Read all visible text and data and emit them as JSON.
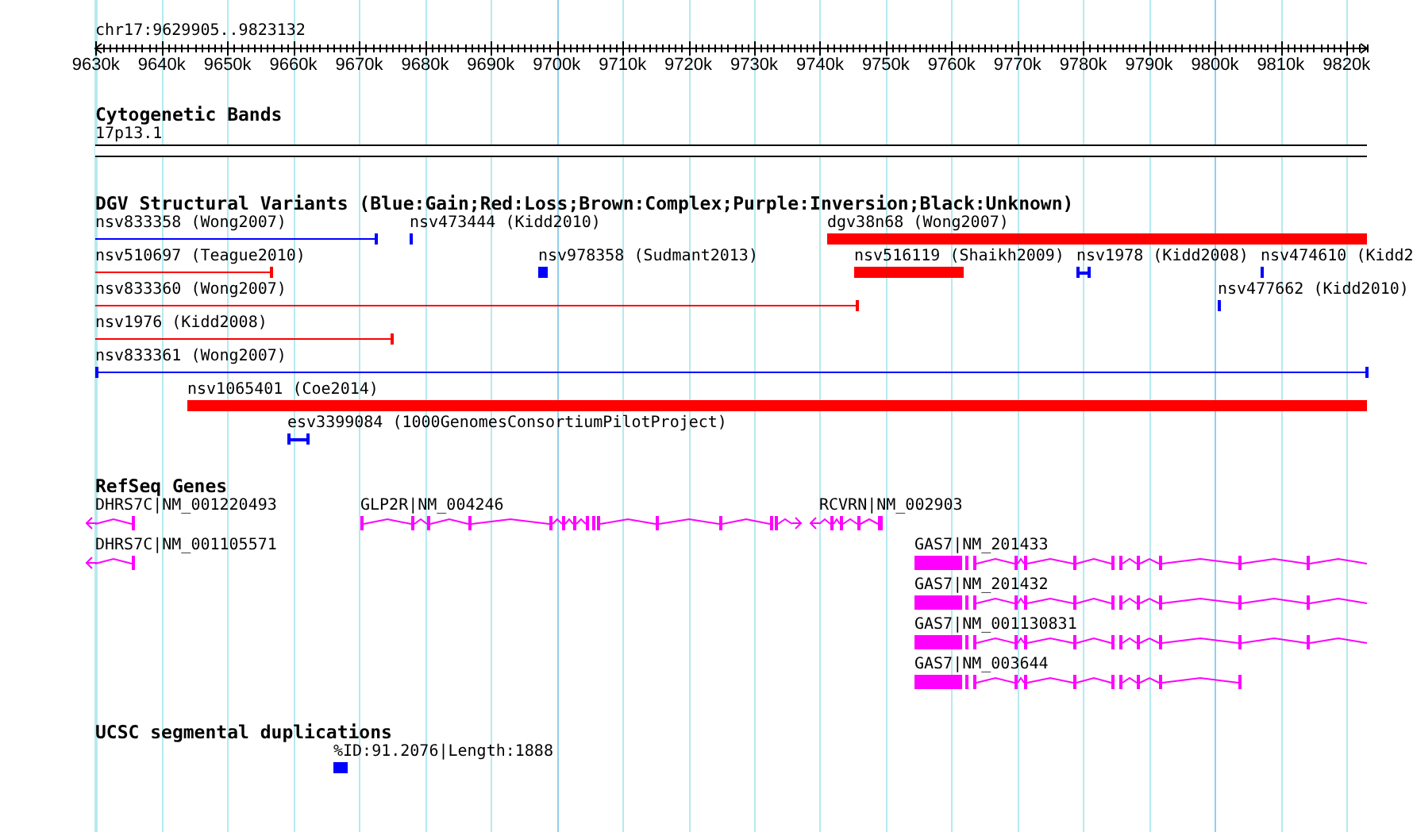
{
  "region_label": "chr17:9629905..9823132",
  "ruler": {
    "ticks": [
      {
        "label": "9630k"
      },
      {
        "label": "9640k"
      },
      {
        "label": "9650k"
      },
      {
        "label": "9660k"
      },
      {
        "label": "9670k"
      },
      {
        "label": "9680k"
      },
      {
        "label": "9690k"
      },
      {
        "label": "9700k"
      },
      {
        "label": "9710k"
      },
      {
        "label": "9720k"
      },
      {
        "label": "9730k"
      },
      {
        "label": "9740k"
      },
      {
        "label": "9750k"
      },
      {
        "label": "9760k"
      },
      {
        "label": "9770k"
      },
      {
        "label": "9780k"
      },
      {
        "label": "9790k"
      },
      {
        "label": "9800k"
      },
      {
        "label": "9810k"
      },
      {
        "label": "9820k"
      }
    ]
  },
  "tracks": [
    {
      "kind": "cytoband",
      "title": "Cytogenetic Bands",
      "bands": [
        {
          "label": "17p13.1"
        }
      ]
    },
    {
      "kind": "variants",
      "title": "DGV Structural Variants (Blue:Gain;Red:Loss;Brown:Complex;Purple:Inversion;Black:Unknown)",
      "features": [
        {
          "label": "nsv833358 (Wong2007)",
          "color": "#0000ff",
          "kind": "line"
        },
        {
          "label": "nsv473444 (Kidd2010)",
          "color": "#0000ff",
          "kind": "bar"
        },
        {
          "label": "dgv38n68 (Wong2007)",
          "color": "#ff0000",
          "kind": "bar"
        },
        {
          "label": "nsv510697 (Teague2010)",
          "color": "#ff0000",
          "kind": "line"
        },
        {
          "label": "nsv978358 (Sudmant2013)",
          "color": "#0000ff",
          "kind": "bar"
        },
        {
          "label": "nsv516119 (Shaikh2009)",
          "color": "#ff0000",
          "kind": "bar"
        },
        {
          "label": "nsv1978 (Kidd2008)",
          "color": "#0000ff",
          "kind": "line"
        },
        {
          "label": "nsv474610 (Kidd2",
          "color": "#0000ff",
          "kind": "bar"
        },
        {
          "label": "nsv833360 (Wong2007)",
          "color": "#ff0000",
          "kind": "line"
        },
        {
          "label": "nsv477662 (Kidd2010)",
          "color": "#0000ff",
          "kind": "bar"
        },
        {
          "label": "nsv1976 (Kidd2008)",
          "color": "#ff0000",
          "kind": "line"
        },
        {
          "label": "nsv833361 (Wong2007)",
          "color": "#0000ff",
          "kind": "line"
        },
        {
          "label": "nsv1065401 (Coe2014)",
          "color": "#ff0000",
          "kind": "bar"
        },
        {
          "label": "esv3399084 (1000GenomesConsortiumPilotProject)",
          "color": "#0000ff",
          "kind": "line"
        }
      ]
    },
    {
      "kind": "genes",
      "title": "RefSeq Genes",
      "features": [
        {
          "label": "DHRS7C|NM_001220493",
          "arrow_left": true,
          "arrow_right": false
        },
        {
          "label": "GLP2R|NM_004246",
          "arrow_left": false,
          "arrow_right": true
        },
        {
          "label": "RCVRN|NM_002903",
          "arrow_left": true,
          "arrow_right": false
        },
        {
          "label": "DHRS7C|NM_001105571",
          "arrow_left": true,
          "arrow_right": false
        },
        {
          "label": "GAS7|NM_201433",
          "arrow_left": false,
          "arrow_right": false
        },
        {
          "label": "GAS7|NM_201432",
          "arrow_left": false,
          "arrow_right": false
        },
        {
          "label": "GAS7|NM_001130831",
          "arrow_left": false,
          "arrow_right": false
        },
        {
          "label": "GAS7|NM_003644",
          "arrow_left": false,
          "arrow_right": false
        }
      ]
    },
    {
      "kind": "segdups",
      "title": "UCSC segmental duplications",
      "features": [
        {
          "label": "%ID:91.2076|Length:1888"
        }
      ]
    }
  ]
}
